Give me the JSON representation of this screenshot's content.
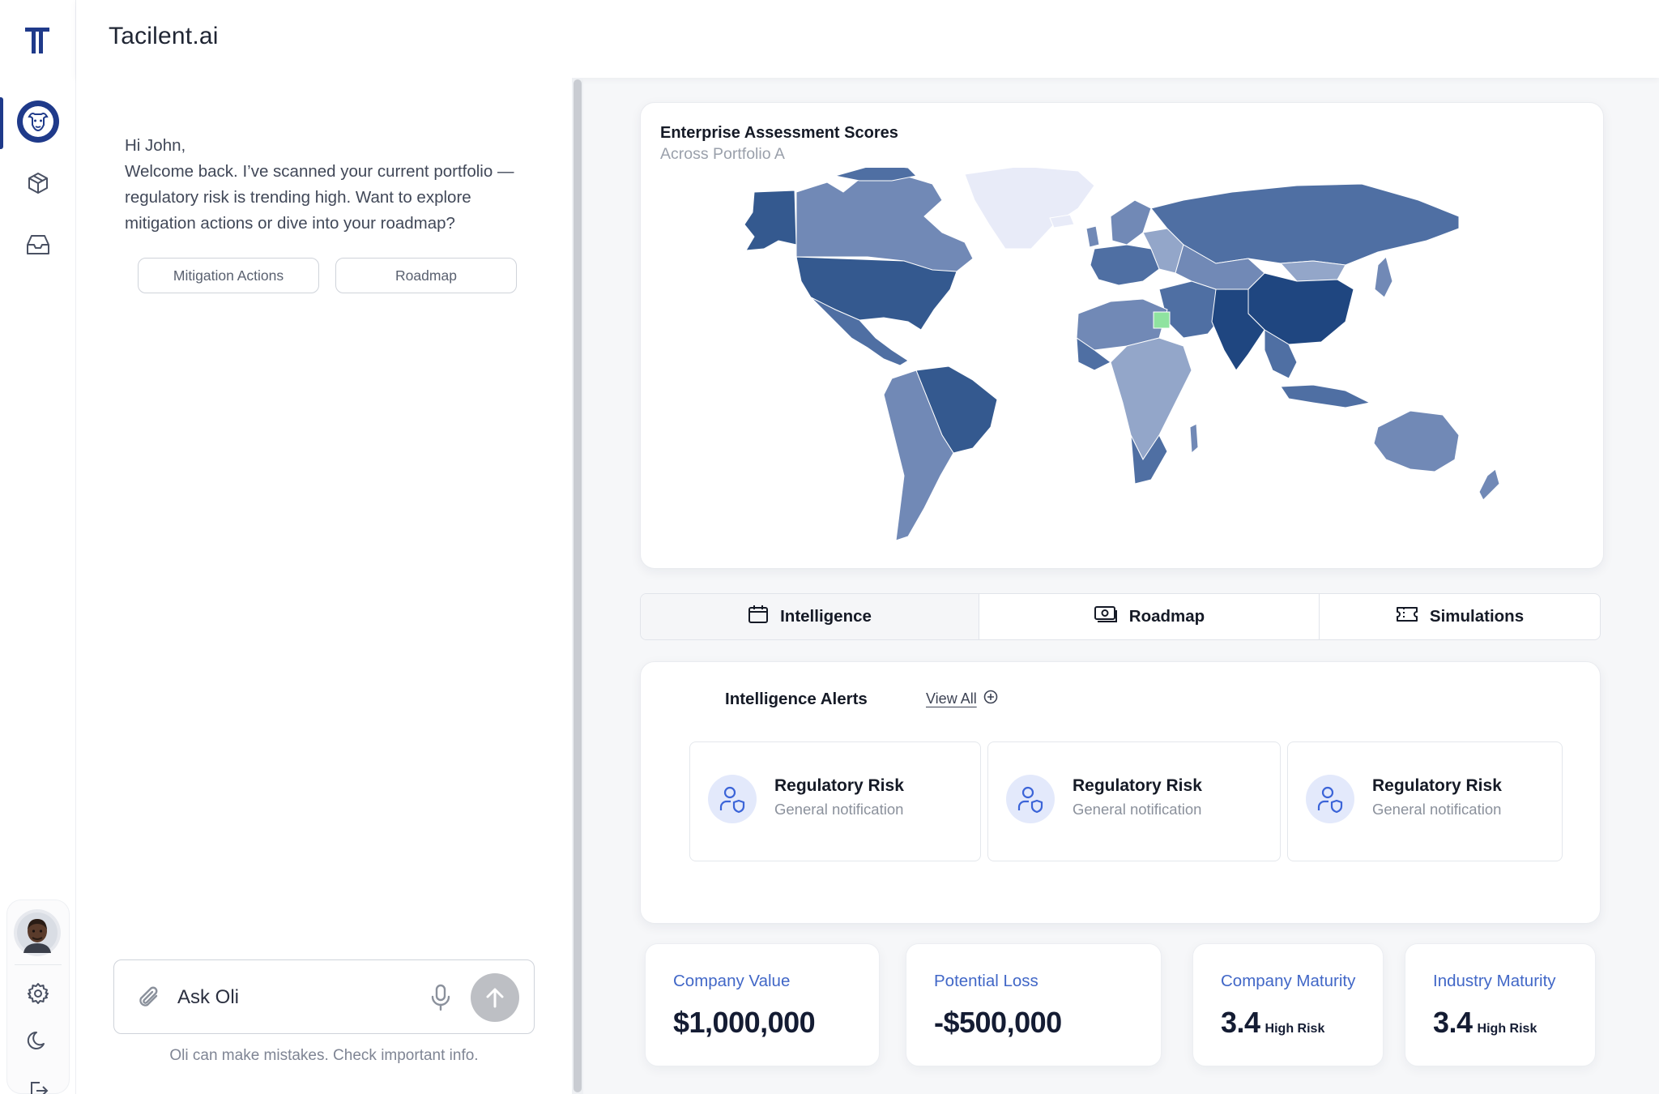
{
  "app": {
    "brand": "Tacilent.ai"
  },
  "sidebar": {
    "items": [
      {
        "icon": "bison-icon",
        "active": true
      },
      {
        "icon": "cube-icon"
      },
      {
        "icon": "inbox-icon"
      }
    ],
    "bottom": [
      "avatar",
      "gear-icon",
      "moon-icon",
      "logout-icon"
    ]
  },
  "chat": {
    "greeting_line1": "Hi John,",
    "greeting_body": "Welcome back. I’ve scanned your current portfolio — regulatory risk is trending high. Want to explore mitigation actions or dive into your roadmap?",
    "suggestions": [
      "Mitigation Actions",
      "Roadmap"
    ],
    "input_placeholder": "Ask Oli",
    "disclaimer": "Oli can make mistakes. Check important info."
  },
  "map": {
    "title": "Enterprise Assessment Scores",
    "subtitle": "Across Portfolio A",
    "colors": {
      "darkest": "#1f4680",
      "dark": "#34598f",
      "mid": "#4f6fa3",
      "light": "#7189b6",
      "lighter": "#93a6c9",
      "lightest": "#e8ebf8",
      "highlight": "#8fe3a0"
    }
  },
  "tabs": [
    {
      "label": "Intelligence",
      "icon": "calendar-icon",
      "active": true
    },
    {
      "label": "Roadmap",
      "icon": "money-icon",
      "active": false
    },
    {
      "label": "Simulations",
      "icon": "ticket-icon",
      "active": false
    }
  ],
  "alerts": {
    "title": "Intelligence Alerts",
    "view_all": "View All",
    "items": [
      {
        "title": "Regulatory Risk",
        "subtitle": "General notification"
      },
      {
        "title": "Regulatory Risk",
        "subtitle": "General notification"
      },
      {
        "title": "Regulatory Risk",
        "subtitle": "General notification"
      }
    ]
  },
  "metrics": [
    {
      "label": "Company Value",
      "value": "$1,000,000",
      "note": ""
    },
    {
      "label": "Potential Loss",
      "value": "-$500,000",
      "note": ""
    },
    {
      "label": "Company Maturity",
      "value": "3.4",
      "note": "High Risk"
    },
    {
      "label": "Industry Maturity",
      "value": "3.4",
      "note": "High Risk"
    }
  ]
}
